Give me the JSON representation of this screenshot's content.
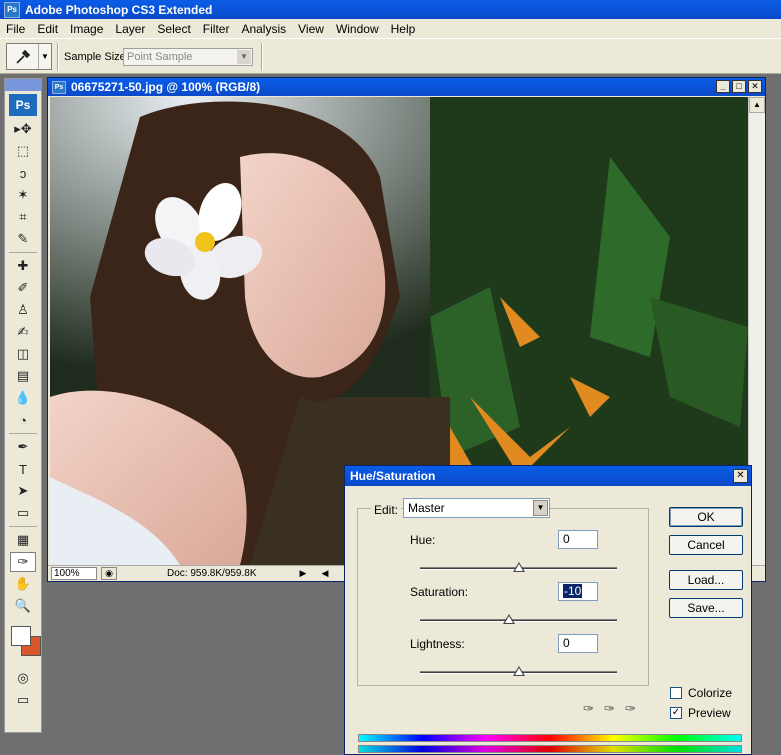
{
  "app": {
    "title": "Adobe Photoshop CS3 Extended",
    "icon": "Ps"
  },
  "menu": [
    "File",
    "Edit",
    "Image",
    "Layer",
    "Select",
    "Filter",
    "Analysis",
    "View",
    "Window",
    "Help"
  ],
  "options": {
    "sample_label": "Sample Size:",
    "sample_value": "Point Sample"
  },
  "toolbox": {
    "logo": "Ps",
    "tools": [
      {
        "name": "move-tool-icon",
        "glyph": "▸✥"
      },
      {
        "name": "marquee-tool-icon",
        "glyph": "⬚"
      },
      {
        "name": "lasso-tool-icon",
        "glyph": "ↄ"
      },
      {
        "name": "magic-wand-tool-icon",
        "glyph": "✶"
      },
      {
        "name": "crop-tool-icon",
        "glyph": "⌗"
      },
      {
        "name": "slice-tool-icon",
        "glyph": "✎"
      },
      {
        "name": "healing-brush-tool-icon",
        "glyph": "✚"
      },
      {
        "name": "brush-tool-icon",
        "glyph": "✐"
      },
      {
        "name": "clone-stamp-tool-icon",
        "glyph": "♙"
      },
      {
        "name": "history-brush-tool-icon",
        "glyph": "✍"
      },
      {
        "name": "eraser-tool-icon",
        "glyph": "◫"
      },
      {
        "name": "gradient-tool-icon",
        "glyph": "▤"
      },
      {
        "name": "blur-tool-icon",
        "glyph": "💧"
      },
      {
        "name": "dodge-tool-icon",
        "glyph": "◔"
      },
      {
        "name": "pen-tool-icon",
        "glyph": "✒"
      },
      {
        "name": "type-tool-icon",
        "glyph": "T"
      },
      {
        "name": "path-selection-tool-icon",
        "glyph": "➤"
      },
      {
        "name": "shape-tool-icon",
        "glyph": "▭"
      },
      {
        "name": "notes-tool-icon",
        "glyph": "▦"
      },
      {
        "name": "eyedropper-tool-icon",
        "glyph": "✑"
      },
      {
        "name": "hand-tool-icon",
        "glyph": "✋"
      },
      {
        "name": "zoom-tool-icon",
        "glyph": "🔍"
      }
    ],
    "foreground_color": "#ffffff",
    "background_color": "#d9552a"
  },
  "document": {
    "title": "06675271-50.jpg @ 100% (RGB/8)",
    "zoom": "100%",
    "doc_info": "Doc: 959.8K/959.8K"
  },
  "dialog": {
    "title": "Hue/Saturation",
    "edit_label": "Edit:",
    "edit_value": "Master",
    "hue": {
      "label": "Hue:",
      "value": "0",
      "slider": 0.5
    },
    "saturation": {
      "label": "Saturation:",
      "value": "-10",
      "slider": 0.45
    },
    "lightness": {
      "label": "Lightness:",
      "value": "0",
      "slider": 0.5
    },
    "buttons": {
      "ok": "OK",
      "cancel": "Cancel",
      "load": "Load...",
      "save": "Save..."
    },
    "colorize": {
      "label": "Colorize",
      "checked": false
    },
    "preview": {
      "label": "Preview",
      "checked": true
    }
  }
}
